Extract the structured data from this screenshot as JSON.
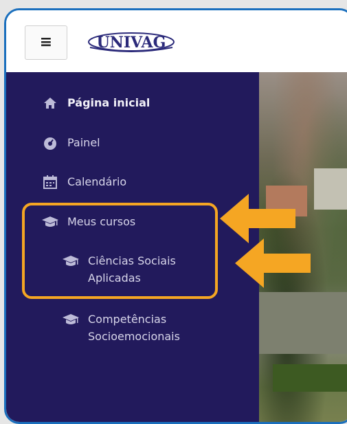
{
  "logo": {
    "text": "UNIVAG"
  },
  "header": {
    "menu_icon": "hamburger-icon",
    "menu_glyph": "≡"
  },
  "nav": {
    "home": {
      "label": "Página inicial",
      "icon": "home-icon"
    },
    "dashboard": {
      "label": "Painel",
      "icon": "dashboard-icon"
    },
    "calendar": {
      "label": "Calendário",
      "icon": "calendar-icon"
    },
    "my_courses": {
      "label": "Meus cursos",
      "icon": "graduation-cap-icon"
    },
    "courses": [
      {
        "label": "Ciências Sociais Aplicadas",
        "icon": "graduation-cap-icon"
      },
      {
        "label": "Competências Socioemocionais",
        "icon": "graduation-cap-icon"
      }
    ]
  },
  "colors": {
    "sidebar": "#221a5c",
    "frame_border": "#1a6fbd",
    "highlight": "#f5a623",
    "logo": "#2b2a7a"
  }
}
